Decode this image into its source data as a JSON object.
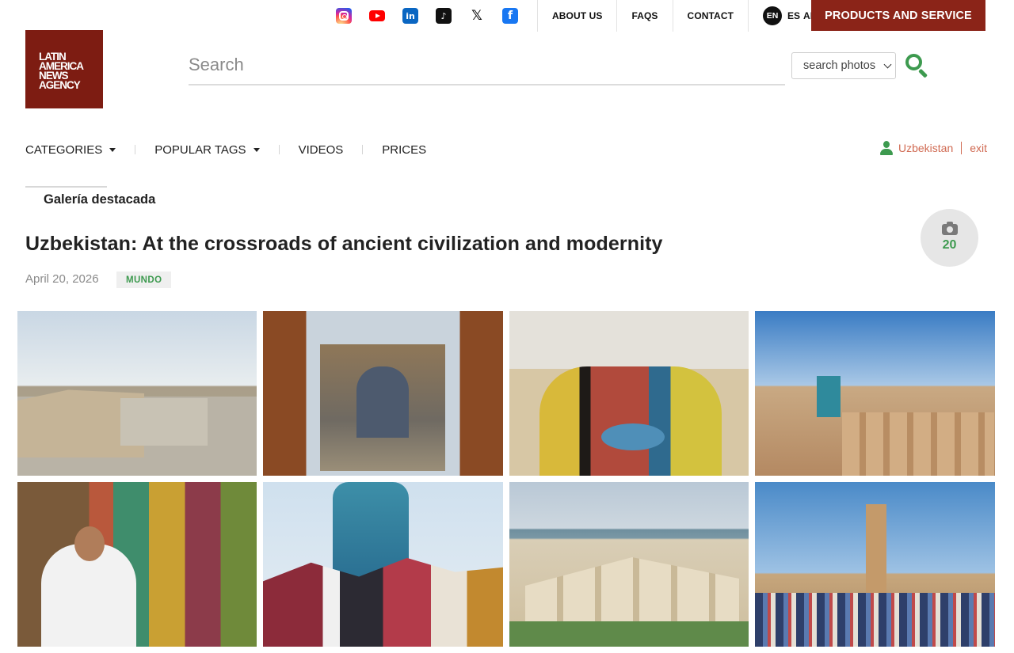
{
  "social": [
    {
      "name": "instagram"
    },
    {
      "name": "youtube"
    },
    {
      "name": "linkedin",
      "glyph": "in"
    },
    {
      "name": "tiktok",
      "glyph": "♪"
    },
    {
      "name": "x",
      "glyph": "𝕏"
    },
    {
      "name": "facebook",
      "glyph": "f"
    }
  ],
  "topnav": {
    "about": "ABOUT US",
    "faqs": "FAQS",
    "contact": "CONTACT",
    "lang_current": "EN",
    "lang_es": "ES",
    "lang_ar": "AR",
    "products": "PRODUCTS AND SERVICE"
  },
  "logo": {
    "line1": "LATIN",
    "line2": "AMERICA",
    "line3": "NEWS",
    "line4": "AGENCY"
  },
  "search": {
    "placeholder": "Search",
    "filter_value": "search photos"
  },
  "mainnav": {
    "categories": "CATEGORIES",
    "popular_tags": "POPULAR TAGS",
    "videos": "VIDEOS",
    "prices": "PRICES"
  },
  "user": {
    "name": "Uzbekistan",
    "exit": "exit"
  },
  "gallery": {
    "featured_label": "Galería destacada",
    "title": "Uzbekistan: At the crossroads of ancient civilization and modernity",
    "date": "April 20, 2026",
    "tag": "MUNDO",
    "photo_count": "20"
  },
  "colors": {
    "brand": "#7d1c12",
    "products_bg": "#8b2418",
    "accent_green": "#3d9a4f",
    "user_link": "#d06a52"
  }
}
